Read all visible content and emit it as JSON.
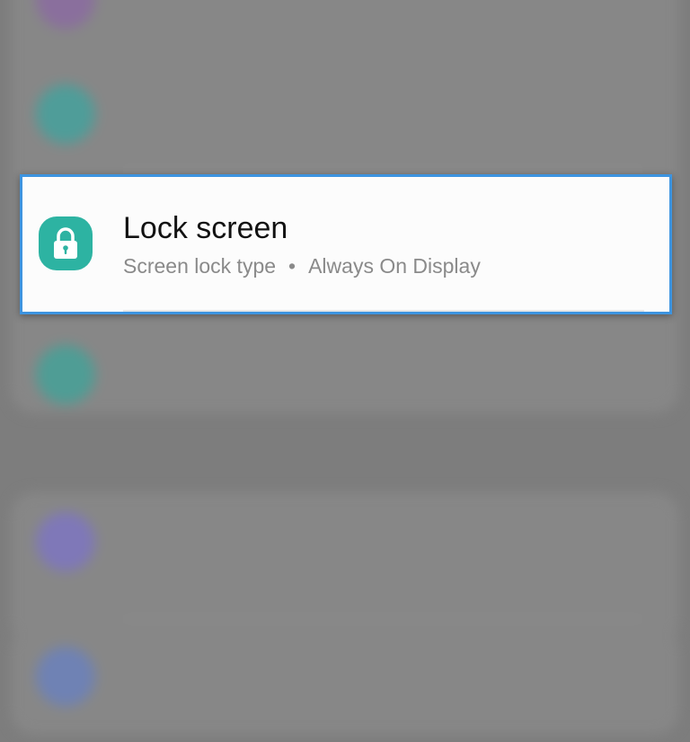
{
  "settings_list": {
    "selected_item": {
      "title": "Lock screen",
      "subtitle_parts": [
        "Screen lock type",
        "Always On Display"
      ],
      "separator": "•",
      "icon": "lock-icon",
      "icon_color": "#2db3a2"
    }
  },
  "colors": {
    "highlight_border": "#3d94e0",
    "background_dim": "#7d7d7d"
  }
}
